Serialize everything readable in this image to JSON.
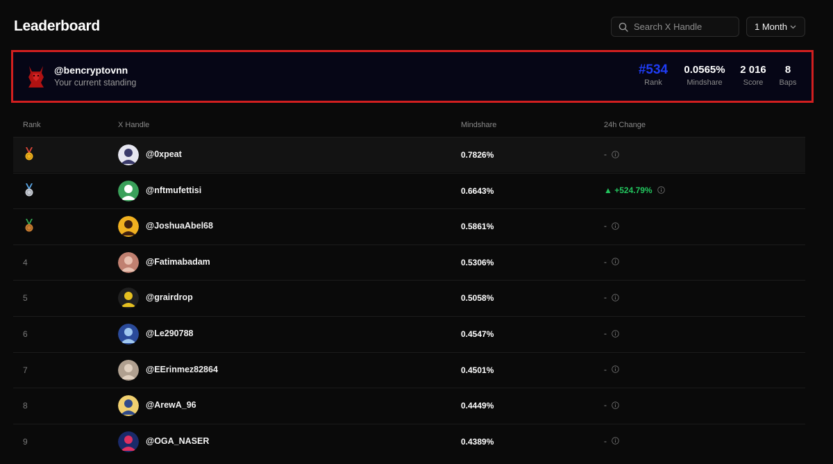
{
  "header": {
    "title": "Leaderboard",
    "search_placeholder": "Search X Handle",
    "period": "1 Month"
  },
  "standing": {
    "handle": "@bencryptovnn",
    "subtitle": "Your current standing",
    "rank": "#534",
    "rank_label": "Rank",
    "mindshare": "0.0565%",
    "mindshare_label": "Mindshare",
    "score": "2 016",
    "score_label": "Score",
    "baps": "8",
    "baps_label": "Baps"
  },
  "table": {
    "columns": [
      "Rank",
      "X Handle",
      "Mindshare",
      "24h Change"
    ],
    "rows": [
      {
        "rank": "1",
        "medal": "gold",
        "handle": "@0xpeat",
        "mindshare": "0.7826%",
        "change": "-",
        "positive": false
      },
      {
        "rank": "2",
        "medal": "silver",
        "handle": "@nftmufettisi",
        "mindshare": "0.6643%",
        "change": "▲ +524.79%",
        "positive": true
      },
      {
        "rank": "3",
        "medal": "bronze",
        "handle": "@JoshuaAbel68",
        "mindshare": "0.5861%",
        "change": "-",
        "positive": false
      },
      {
        "rank": "4",
        "medal": "",
        "handle": "@Fatimabadam",
        "mindshare": "0.5306%",
        "change": "-",
        "positive": false
      },
      {
        "rank": "5",
        "medal": "",
        "handle": "@grairdrop",
        "mindshare": "0.5058%",
        "change": "-",
        "positive": false
      },
      {
        "rank": "6",
        "medal": "",
        "handle": "@Le290788",
        "mindshare": "0.4547%",
        "change": "-",
        "positive": false
      },
      {
        "rank": "7",
        "medal": "",
        "handle": "@EErinmez82864",
        "mindshare": "0.4501%",
        "change": "-",
        "positive": false
      },
      {
        "rank": "8",
        "medal": "",
        "handle": "@ArewA_96",
        "mindshare": "0.4449%",
        "change": "-",
        "positive": false
      },
      {
        "rank": "9",
        "medal": "",
        "handle": "@OGA_NASER",
        "mindshare": "0.4389%",
        "change": "-",
        "positive": false
      }
    ]
  },
  "colors": {
    "highlight_border": "#d21f1f",
    "rank_accent": "#1f3cf5",
    "positive": "#22c55e"
  }
}
